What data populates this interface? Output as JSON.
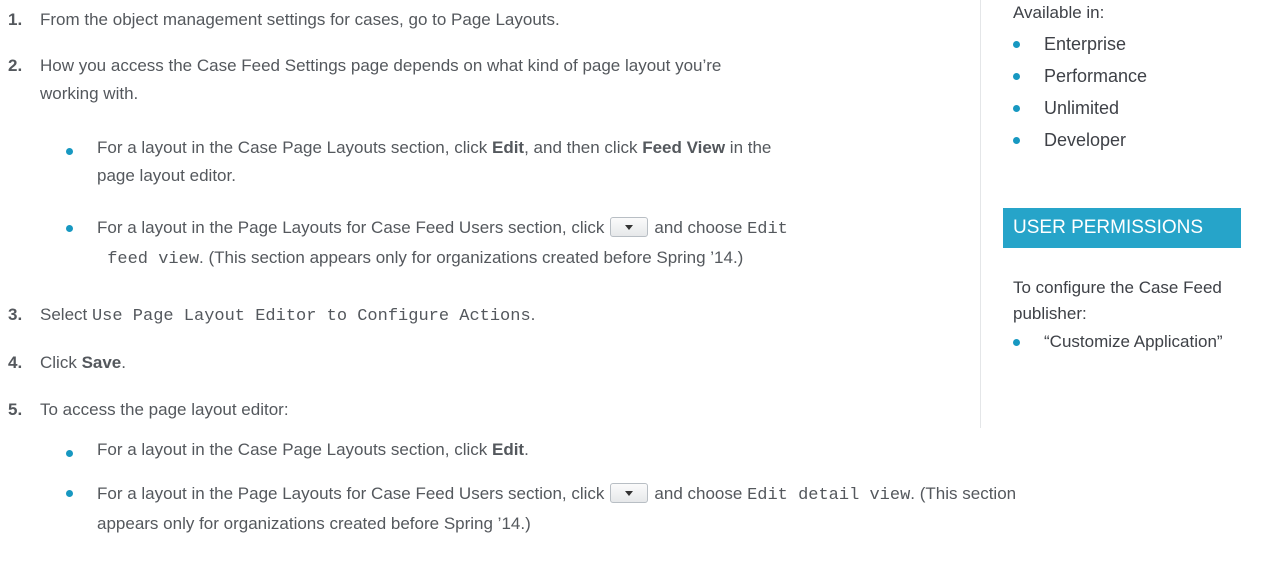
{
  "steps": [
    {
      "num": "1.",
      "text": "From the object management settings for cases, go to Page Layouts."
    },
    {
      "num": "2.",
      "line1": "How you access the Case Feed Settings page depends on what kind of page layout you’re",
      "line2": "working with."
    },
    {
      "num": "3.",
      "prefix": "Select ",
      "code": "Use Page Layout Editor to Configure Actions",
      "suffix": "."
    },
    {
      "num": "4.",
      "prefix": "Click ",
      "bold": "Save",
      "suffix": "."
    },
    {
      "num": "5.",
      "text": "To access the page layout editor:"
    }
  ],
  "step2_bullets": [
    {
      "a": "For a layout in the Case Page Layouts section, click ",
      "b1": "Edit",
      "c": ", and then click ",
      "b2": "Feed View",
      "d": " in the",
      "line2": "page layout editor."
    },
    {
      "a": "For a layout in the Page Layouts for Case Feed Users section, click",
      "c": "and choose ",
      "code1": "Edit",
      "code2": "feed view",
      "d": ". (This section appears only for organizations created before Spring ’14.)"
    }
  ],
  "step5_bullets": [
    {
      "a": "For a layout in the Case Page Layouts section, click ",
      "b1": "Edit",
      "d": "."
    },
    {
      "a": "For a layout in the Page Layouts for Case Feed Users section, click",
      "c": "and choose ",
      "code": "Edit detail view",
      "d": ". (This section",
      "line2": "appears only for organizations created before Spring ’14.)"
    }
  ],
  "sidebar": {
    "available_label": "Available in:",
    "editions": [
      "Enterprise",
      "Performance",
      "Unlimited",
      "Developer"
    ],
    "perm_header": "USER PERMISSIONS",
    "perm_line1": "To configure the Case Feed",
    "perm_line2": "publisher:",
    "perm_item": "“Customize Application”"
  },
  "colors": {
    "bullet": "#1798c1",
    "header_bg": "#26a4c9",
    "text": "#54585d"
  }
}
